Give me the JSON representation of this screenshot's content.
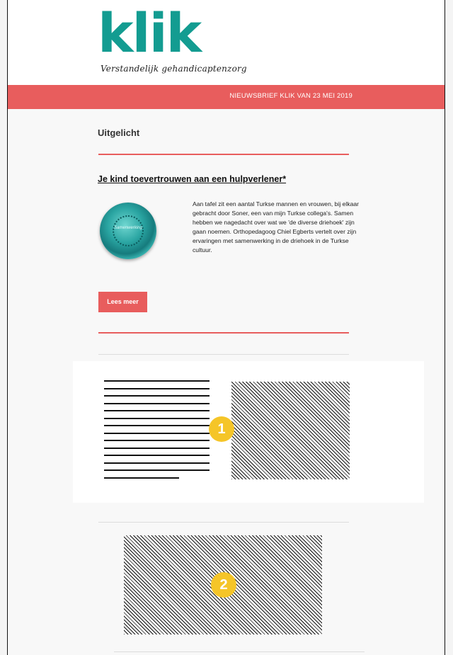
{
  "header": {
    "logo": "klik",
    "tagline": "Verstandelijk gehandicaptenzorg"
  },
  "banner": {
    "text": "NIEUWSBRIEF KLIK VAN 23 MEI 2019"
  },
  "section": {
    "title": "Uitgelicht"
  },
  "article": {
    "title": "Je kind toevertrouwen aan een hulpverlener*",
    "image_label": "Samenwerking",
    "body": "Aan tafel zit een aantal Turkse mannen en vrouwen, bij elkaar gebracht door Soner, een van mijn Turkse collega's. Samen hebben we nagedacht over wat we 'de diverse driehoek' zijn gaan noemen. Orthopedagoog Chiel Egberts vertelt over zijn ervaringen met samenwerking in de driehoek in de Turkse cultuur.",
    "button_label": "Lees meer"
  },
  "placeholders": {
    "block1_badge": "1",
    "block2_badge": "2"
  },
  "colors": {
    "accent": "#e85d5d",
    "brand": "#139c91",
    "badge": "#f5c528"
  }
}
